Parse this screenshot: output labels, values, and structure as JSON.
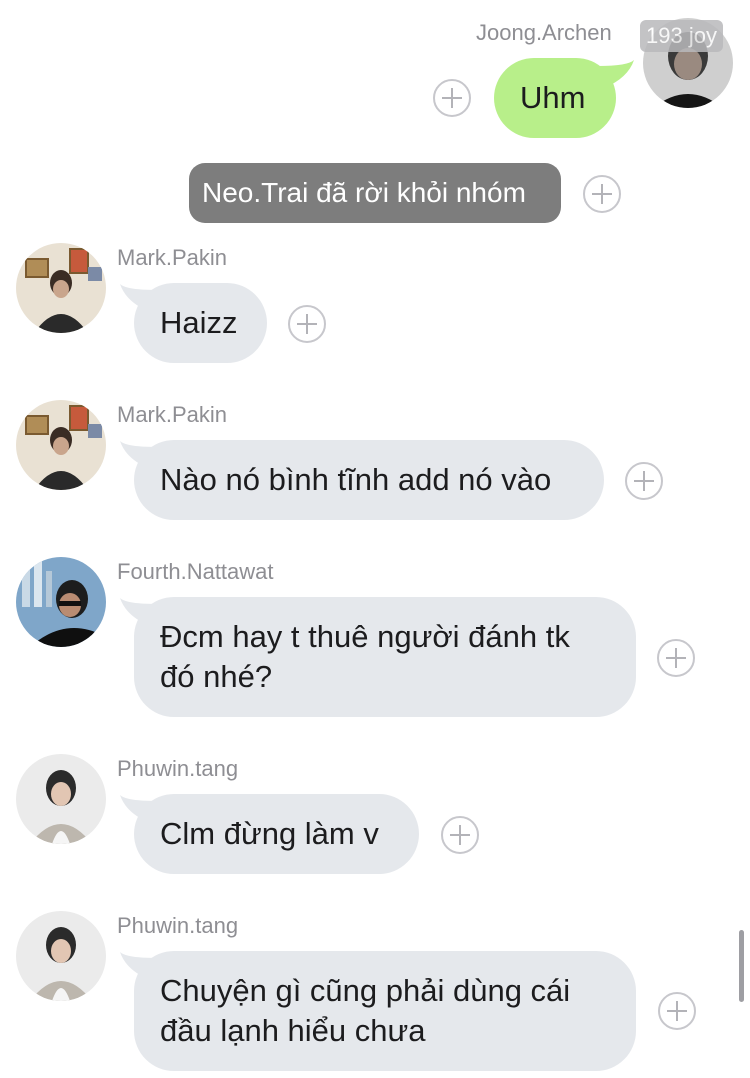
{
  "top_message": {
    "sender": "Joong.Archen",
    "badge": "193 joy",
    "text": "Uhm"
  },
  "system_message": {
    "text": "Neo.Trai đã rời khỏi nhóm"
  },
  "messages": [
    {
      "sender": "Mark.Pakin",
      "lines": [
        "Haizz"
      ]
    },
    {
      "sender": "Mark.Pakin",
      "lines": [
        "Nào nó bình tĩnh add nó vào"
      ]
    },
    {
      "sender": "Fourth.Nattawat",
      "lines": [
        "Đcm hay t thuê người đánh tk",
        "đó nhé?"
      ]
    },
    {
      "sender": "Phuwin.tang",
      "lines": [
        "Clm đừng làm v"
      ]
    },
    {
      "sender": "Phuwin.tang",
      "lines": [
        "Chuyện gì cũng phải dùng cái",
        "đầu lạnh hiểu chưa"
      ]
    }
  ],
  "icons": {
    "reaction": "add-reaction-icon",
    "avatar": "user-avatar"
  },
  "colors": {
    "outgoing_bubble": "#b8ef8a",
    "incoming_bubble": "#e5e8ec",
    "system_bubble": "#7d7d7d"
  }
}
